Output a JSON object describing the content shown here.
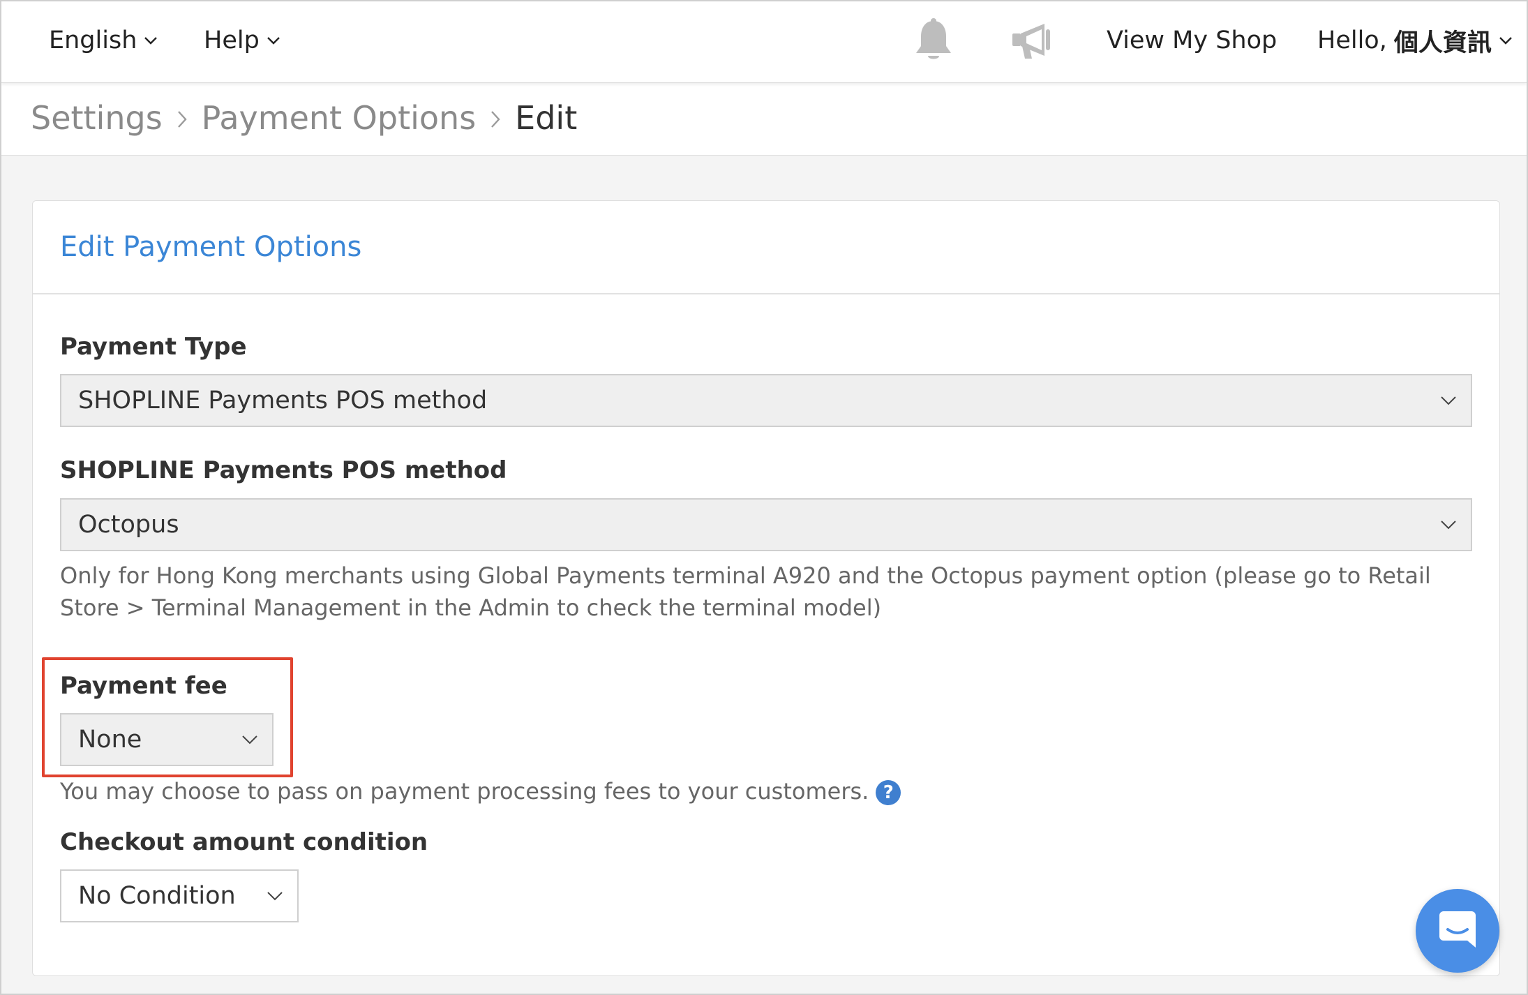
{
  "topbar": {
    "language": "English",
    "help": "Help",
    "view_shop": "View My Shop",
    "hello_prefix": "Hello,",
    "user_name": "個人資訊"
  },
  "breadcrumb": {
    "items": [
      "Settings",
      "Payment Options"
    ],
    "current": "Edit"
  },
  "card": {
    "title": "Edit Payment Options"
  },
  "form": {
    "payment_type": {
      "label": "Payment Type",
      "value": "SHOPLINE Payments POS method"
    },
    "pos_method": {
      "label": "SHOPLINE Payments POS method",
      "value": "Octopus",
      "help": "Only for Hong Kong merchants using Global Payments terminal A920 and the Octopus payment option (please go to Retail Store > Terminal Management in the Admin to check the terminal model)"
    },
    "payment_fee": {
      "label": "Payment fee",
      "value": "None",
      "help": "You may choose to pass on payment processing fees to your customers."
    },
    "checkout_condition": {
      "label": "Checkout amount condition",
      "value": "No Condition"
    }
  },
  "colors": {
    "accent": "#3b86d6",
    "highlight": "#e0432f",
    "chat": "#4a8ee6"
  },
  "icons": [
    "bell-icon",
    "megaphone-icon",
    "chevron-down-icon",
    "question-icon",
    "chat-icon"
  ]
}
